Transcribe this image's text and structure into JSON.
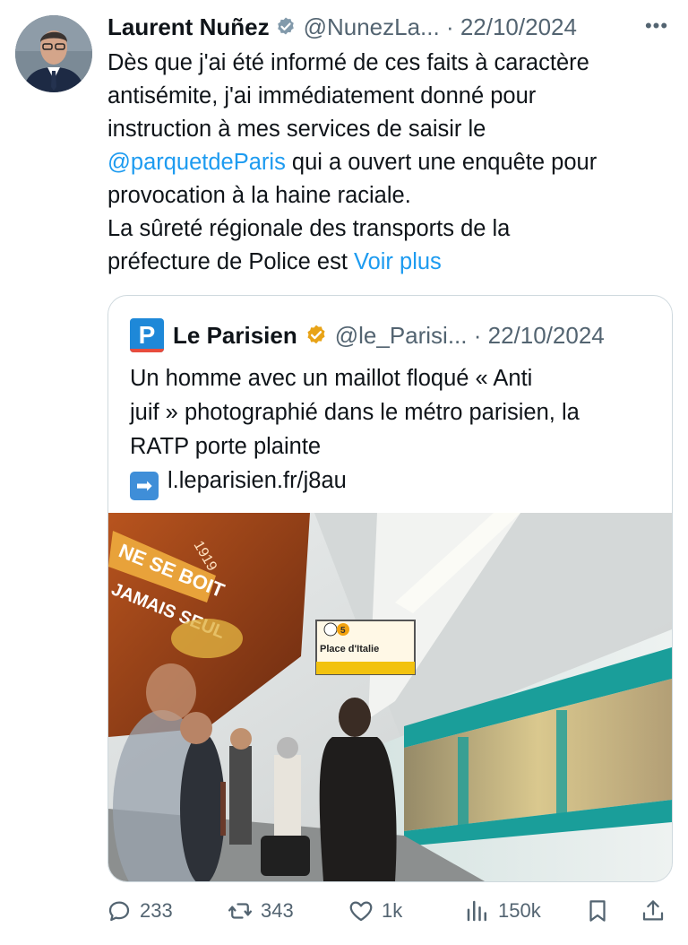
{
  "author": {
    "name": "Laurent Nuñez",
    "handle": "@NunezLa...",
    "date": "22/10/2024",
    "more_icon": "more-horizontal-icon"
  },
  "tweet_lines": [
    "Dès que j'ai été informé de ces faits à caractère",
    "antisémite, j'ai immédiatement donné pour",
    "instruction à mes services de saisir le"
  ],
  "mention": "@parquetdeParis",
  "mention_tail": " qui a ouvert une enquête pour",
  "tweet_line5": "provocation à la haine raciale.",
  "tweet_line6": "La sûreté régionale des transports de la",
  "tweet_line7": "préfecture de Police est ",
  "show_more": "Voir plus",
  "quote": {
    "logo_letter": "P",
    "name": "Le Parisien",
    "handle": "@le_Parisi...",
    "date": "22/10/2024",
    "lines": [
      "Un homme avec un maillot floqué « Anti",
      "juif » photographié dans le métro parisien, la",
      "RATP porte plainte"
    ],
    "link": "l.leparisien.fr/j8au",
    "photo_sign": "Place d'Italie",
    "photo_sign_line": "5",
    "photo_poster_1": "NE SE BOIT",
    "photo_poster_2": "JAMAIS SEUL",
    "photo_poster_3": "1919"
  },
  "actions": {
    "replies": "233",
    "reposts": "343",
    "likes": "1k",
    "views": "150k"
  },
  "colors": {
    "link": "#1d9bf0",
    "secondary": "#536471",
    "verified_grey": "#829aab",
    "verified_gold": "#e8a317"
  }
}
